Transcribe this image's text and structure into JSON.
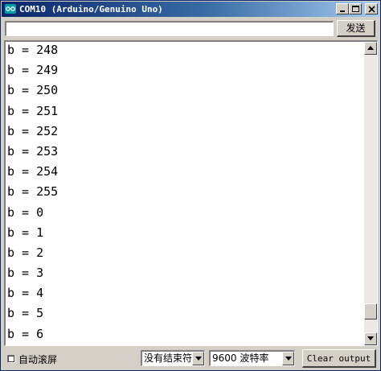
{
  "window": {
    "title": "COM10 (Arduino/Genuino Uno)"
  },
  "send": {
    "input_value": "",
    "button_label": "发送"
  },
  "output": {
    "lines": [
      "b = 248",
      "b = 249",
      "b = 250",
      "b = 251",
      "b = 252",
      "b = 253",
      "b = 254",
      "b = 255",
      "b = 0",
      "b = 1",
      "b = 2",
      "b = 3",
      "b = 4",
      "b = 5",
      "b = 6"
    ],
    "scroll_position": 0.95
  },
  "footer": {
    "autoscroll_label": "自动滚屏",
    "autoscroll_checked": false,
    "line_ending": "没有结束符",
    "baud_rate": "9600 波特率",
    "clear_label": "Clear output"
  },
  "icons": {
    "app": "arduino-logo-icon",
    "minimize": "minimize-icon",
    "maximize": "maximize-icon",
    "close": "close-icon"
  },
  "colors": {
    "titlebar_start": "#0a246a",
    "titlebar_end": "#a6caf0",
    "arduino_teal": "#009da5"
  }
}
